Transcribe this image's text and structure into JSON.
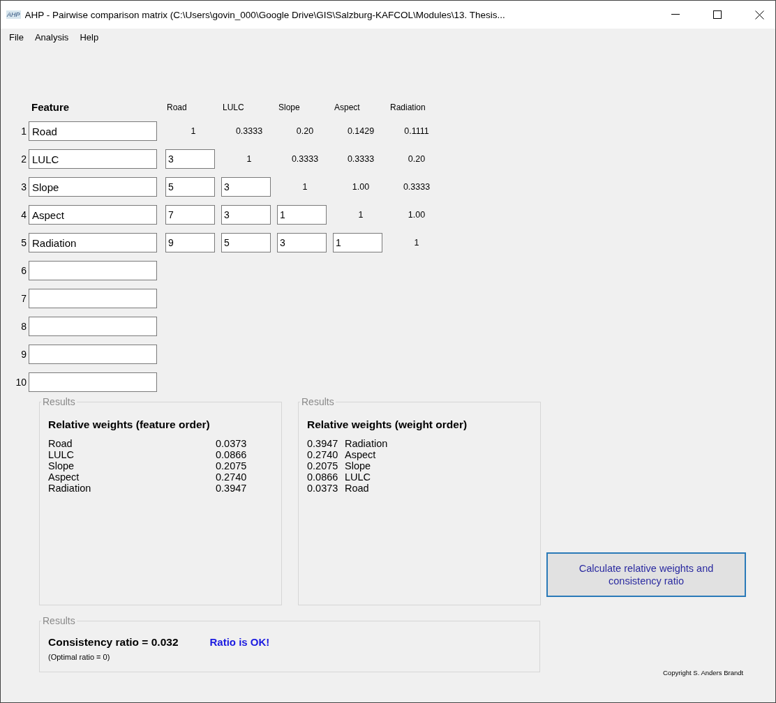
{
  "window": {
    "app_icon_text": "AHP",
    "title": "AHP - Pairwise comparison matrix (C:\\Users\\govin_000\\Google Drive\\GIS\\Salzburg-KAFCOL\\Modules\\13. Thesis..."
  },
  "menu": [
    "File",
    "Analysis",
    "Help"
  ],
  "feature_header": "Feature",
  "matrix_columns": [
    "Road",
    "LULC",
    "Slope",
    "Aspect",
    "Radiation"
  ],
  "rows": [
    {
      "number": "1",
      "feature": "Road",
      "cells": [
        {
          "kind": "text",
          "value": "1"
        },
        {
          "kind": "text",
          "value": "0.3333"
        },
        {
          "kind": "text",
          "value": "0.20"
        },
        {
          "kind": "text",
          "value": "0.1429"
        },
        {
          "kind": "text",
          "value": "0.1111"
        }
      ]
    },
    {
      "number": "2",
      "feature": "LULC",
      "cells": [
        {
          "kind": "input",
          "value": "3"
        },
        {
          "kind": "text",
          "value": "1"
        },
        {
          "kind": "text",
          "value": "0.3333"
        },
        {
          "kind": "text",
          "value": "0.3333"
        },
        {
          "kind": "text",
          "value": "0.20"
        }
      ]
    },
    {
      "number": "3",
      "feature": "Slope",
      "cells": [
        {
          "kind": "input",
          "value": "5"
        },
        {
          "kind": "input",
          "value": "3"
        },
        {
          "kind": "text",
          "value": "1"
        },
        {
          "kind": "text",
          "value": "1.00"
        },
        {
          "kind": "text",
          "value": "0.3333"
        }
      ]
    },
    {
      "number": "4",
      "feature": "Aspect",
      "cells": [
        {
          "kind": "input",
          "value": "7"
        },
        {
          "kind": "input",
          "value": "3"
        },
        {
          "kind": "input",
          "value": "1"
        },
        {
          "kind": "text",
          "value": "1"
        },
        {
          "kind": "text",
          "value": "1.00"
        }
      ]
    },
    {
      "number": "5",
      "feature": "Radiation",
      "cells": [
        {
          "kind": "input",
          "value": "9"
        },
        {
          "kind": "input",
          "value": "5"
        },
        {
          "kind": "input",
          "value": "3"
        },
        {
          "kind": "input",
          "value": "1"
        },
        {
          "kind": "text",
          "value": "1"
        }
      ]
    },
    {
      "number": "6"
    },
    {
      "number": "7"
    },
    {
      "number": "8"
    },
    {
      "number": "9"
    },
    {
      "number": "10"
    }
  ],
  "feature_order_panel": {
    "legend": "Results",
    "heading": "Relative weights (feature order)",
    "items": [
      {
        "name": "Road",
        "weight": "0.0373"
      },
      {
        "name": "LULC",
        "weight": "0.0866"
      },
      {
        "name": "Slope",
        "weight": "0.2075"
      },
      {
        "name": "Aspect",
        "weight": "0.2740"
      },
      {
        "name": "Radiation",
        "weight": "0.3947"
      }
    ]
  },
  "weight_order_panel": {
    "legend": "Results",
    "heading": "Relative weights (weight order)",
    "items": [
      {
        "weight": "0.3947",
        "name": "Radiation"
      },
      {
        "weight": "0.2740",
        "name": "Aspect"
      },
      {
        "weight": "0.2075",
        "name": "Slope"
      },
      {
        "weight": "0.0866",
        "name": "LULC"
      },
      {
        "weight": "0.0373",
        "name": "Road"
      }
    ]
  },
  "consistency_panel": {
    "legend": "Results",
    "ratio": "Consistency ratio = 0.032",
    "status": "Ratio is OK!",
    "note": "(Optimal ratio = 0)"
  },
  "calculate_button": "Calculate relative weights and consistency ratio",
  "copyright": "Copyright S. Anders Brandt"
}
